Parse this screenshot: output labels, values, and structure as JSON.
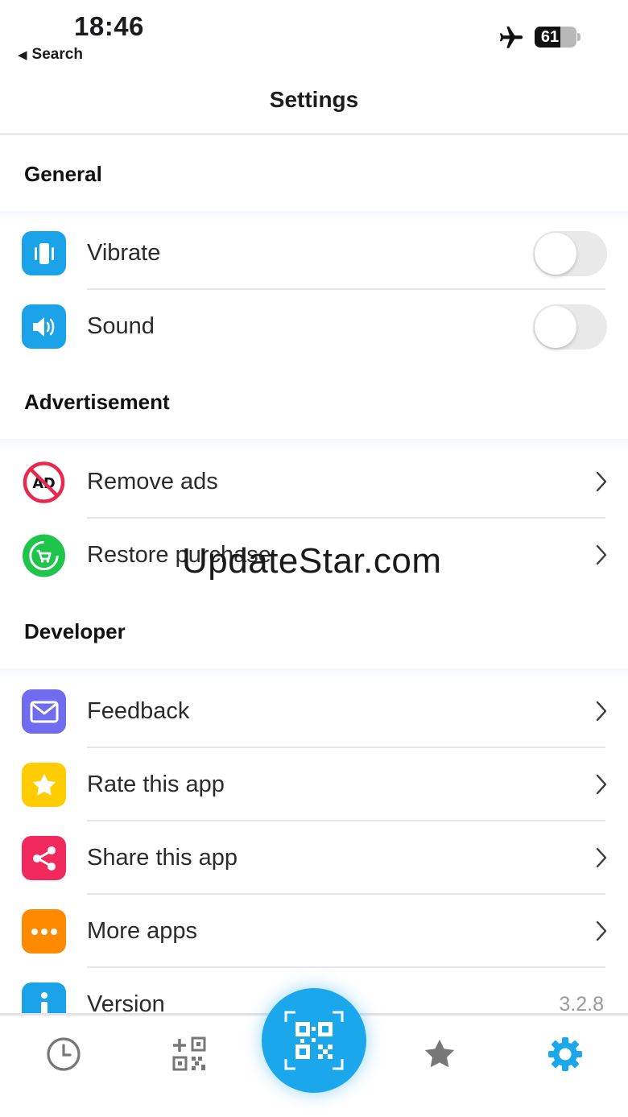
{
  "status_bar": {
    "time": "18:46",
    "back_label": "Search",
    "battery_percent": "61",
    "battery_level": 0.61,
    "airplane_mode": true
  },
  "nav": {
    "title": "Settings"
  },
  "sections": {
    "general": {
      "title": "General",
      "vibrate_label": "Vibrate",
      "vibrate_on": false,
      "sound_label": "Sound",
      "sound_on": false
    },
    "advertisement": {
      "title": "Advertisement",
      "remove_ads_label": "Remove ads",
      "restore_purchase_label": "Restore purchase"
    },
    "developer": {
      "title": "Developer",
      "feedback_label": "Feedback",
      "rate_label": "Rate this app",
      "share_label": "Share this app",
      "more_apps_label": "More apps",
      "version_label": "Version",
      "version_value": "3.2.8"
    }
  },
  "watermark": "UpdateStar.com",
  "tabbar": {
    "items": [
      "history-icon",
      "create-qr-icon",
      "scan-qr-icon",
      "star-icon",
      "gear-icon"
    ],
    "active": "gear-icon",
    "accent_color": "#1aa7ec",
    "inactive_color": "#777777"
  },
  "colors": {
    "vibrate": "#1ba3ea",
    "sound": "#1ba3ea",
    "remove_ads": "#e8294f",
    "restore": "#1fc44a",
    "feedback": "#6f6cf0",
    "rate": "#ffcc00",
    "share": "#f2295c",
    "more_apps": "#ff8a00",
    "version": "#1ba3ea"
  }
}
